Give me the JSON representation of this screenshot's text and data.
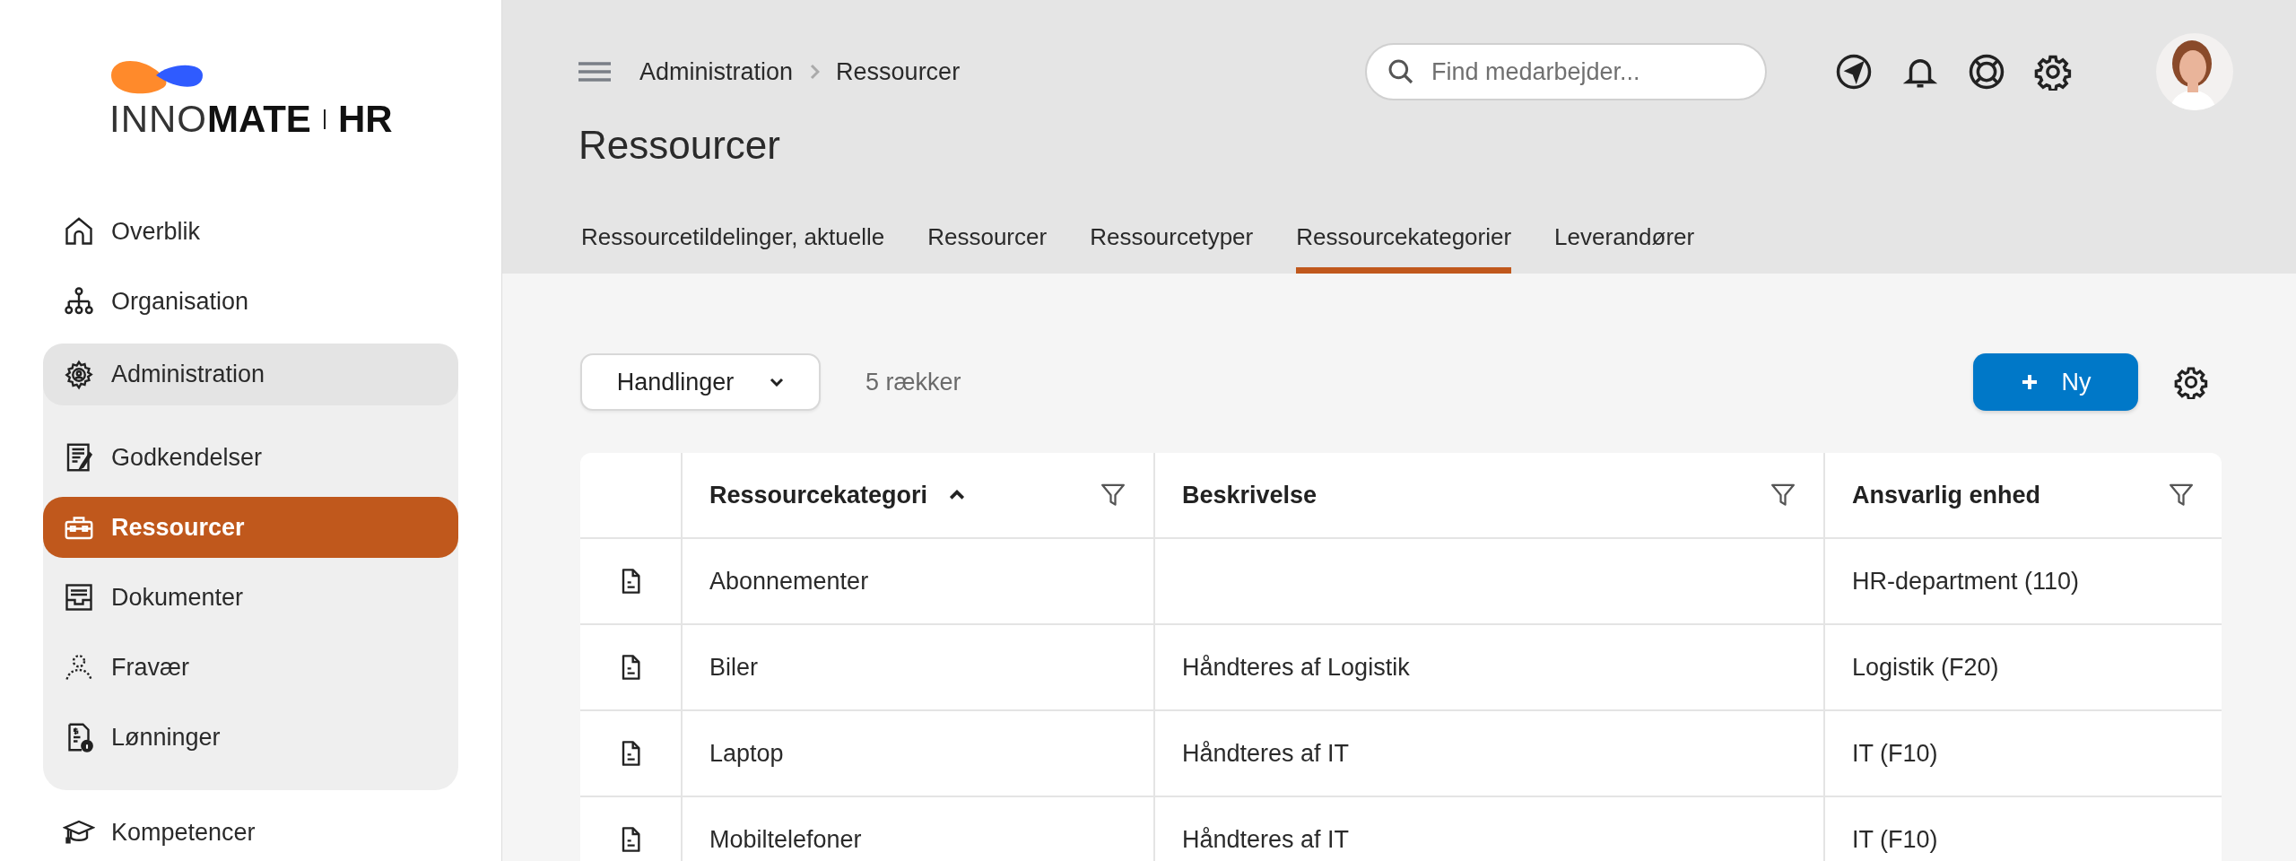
{
  "logo": {
    "brand_light": "INNO",
    "brand_bold": "MATE",
    "product": "HR"
  },
  "sidebar": {
    "items": [
      {
        "label": "Overblik",
        "selected": false
      },
      {
        "label": "Organisation",
        "selected": false
      },
      {
        "label": "Administration",
        "selected": false,
        "expanded": true,
        "children": [
          {
            "label": "Godkendelser",
            "selected": false
          },
          {
            "label": "Ressourcer",
            "selected": true
          },
          {
            "label": "Dokumenter",
            "selected": false
          },
          {
            "label": "Fravær",
            "selected": false
          },
          {
            "label": "Lønninger",
            "selected": false
          }
        ]
      },
      {
        "label": "Kompetencer",
        "selected": false
      }
    ]
  },
  "breadcrumb": [
    "Administration",
    "Ressourcer"
  ],
  "search": {
    "placeholder": "Find medarbejder..."
  },
  "page_title": "Ressourcer",
  "tabs": [
    {
      "label": "Ressourcetildelinger, aktuelle",
      "selected": false
    },
    {
      "label": "Ressourcer",
      "selected": false
    },
    {
      "label": "Ressourcetyper",
      "selected": false
    },
    {
      "label": "Ressourcekategorier",
      "selected": true
    },
    {
      "label": "Leverandører",
      "selected": false
    }
  ],
  "toolbar": {
    "actions": "Handlinger",
    "row_count": "5 rækker",
    "new_button": "Ny"
  },
  "table": {
    "columns": [
      {
        "label": "Ressourcekategori",
        "sorted": true
      },
      {
        "label": "Beskrivelse",
        "sorted": false
      },
      {
        "label": "Ansvarlig enhed",
        "sorted": false
      }
    ],
    "rows": [
      {
        "category": "Abonnementer",
        "unit": "HR-department (110)"
      },
      {
        "category": "Biler",
        "description": "Håndteres af Logistik",
        "unit": "Logistik (F20)"
      },
      {
        "category": "Laptop",
        "description": "Håndteres af IT",
        "unit": "IT (F10)"
      },
      {
        "category": "Mobiltelefoner",
        "description": "Håndteres af IT",
        "unit": "IT (F10)"
      }
    ]
  }
}
